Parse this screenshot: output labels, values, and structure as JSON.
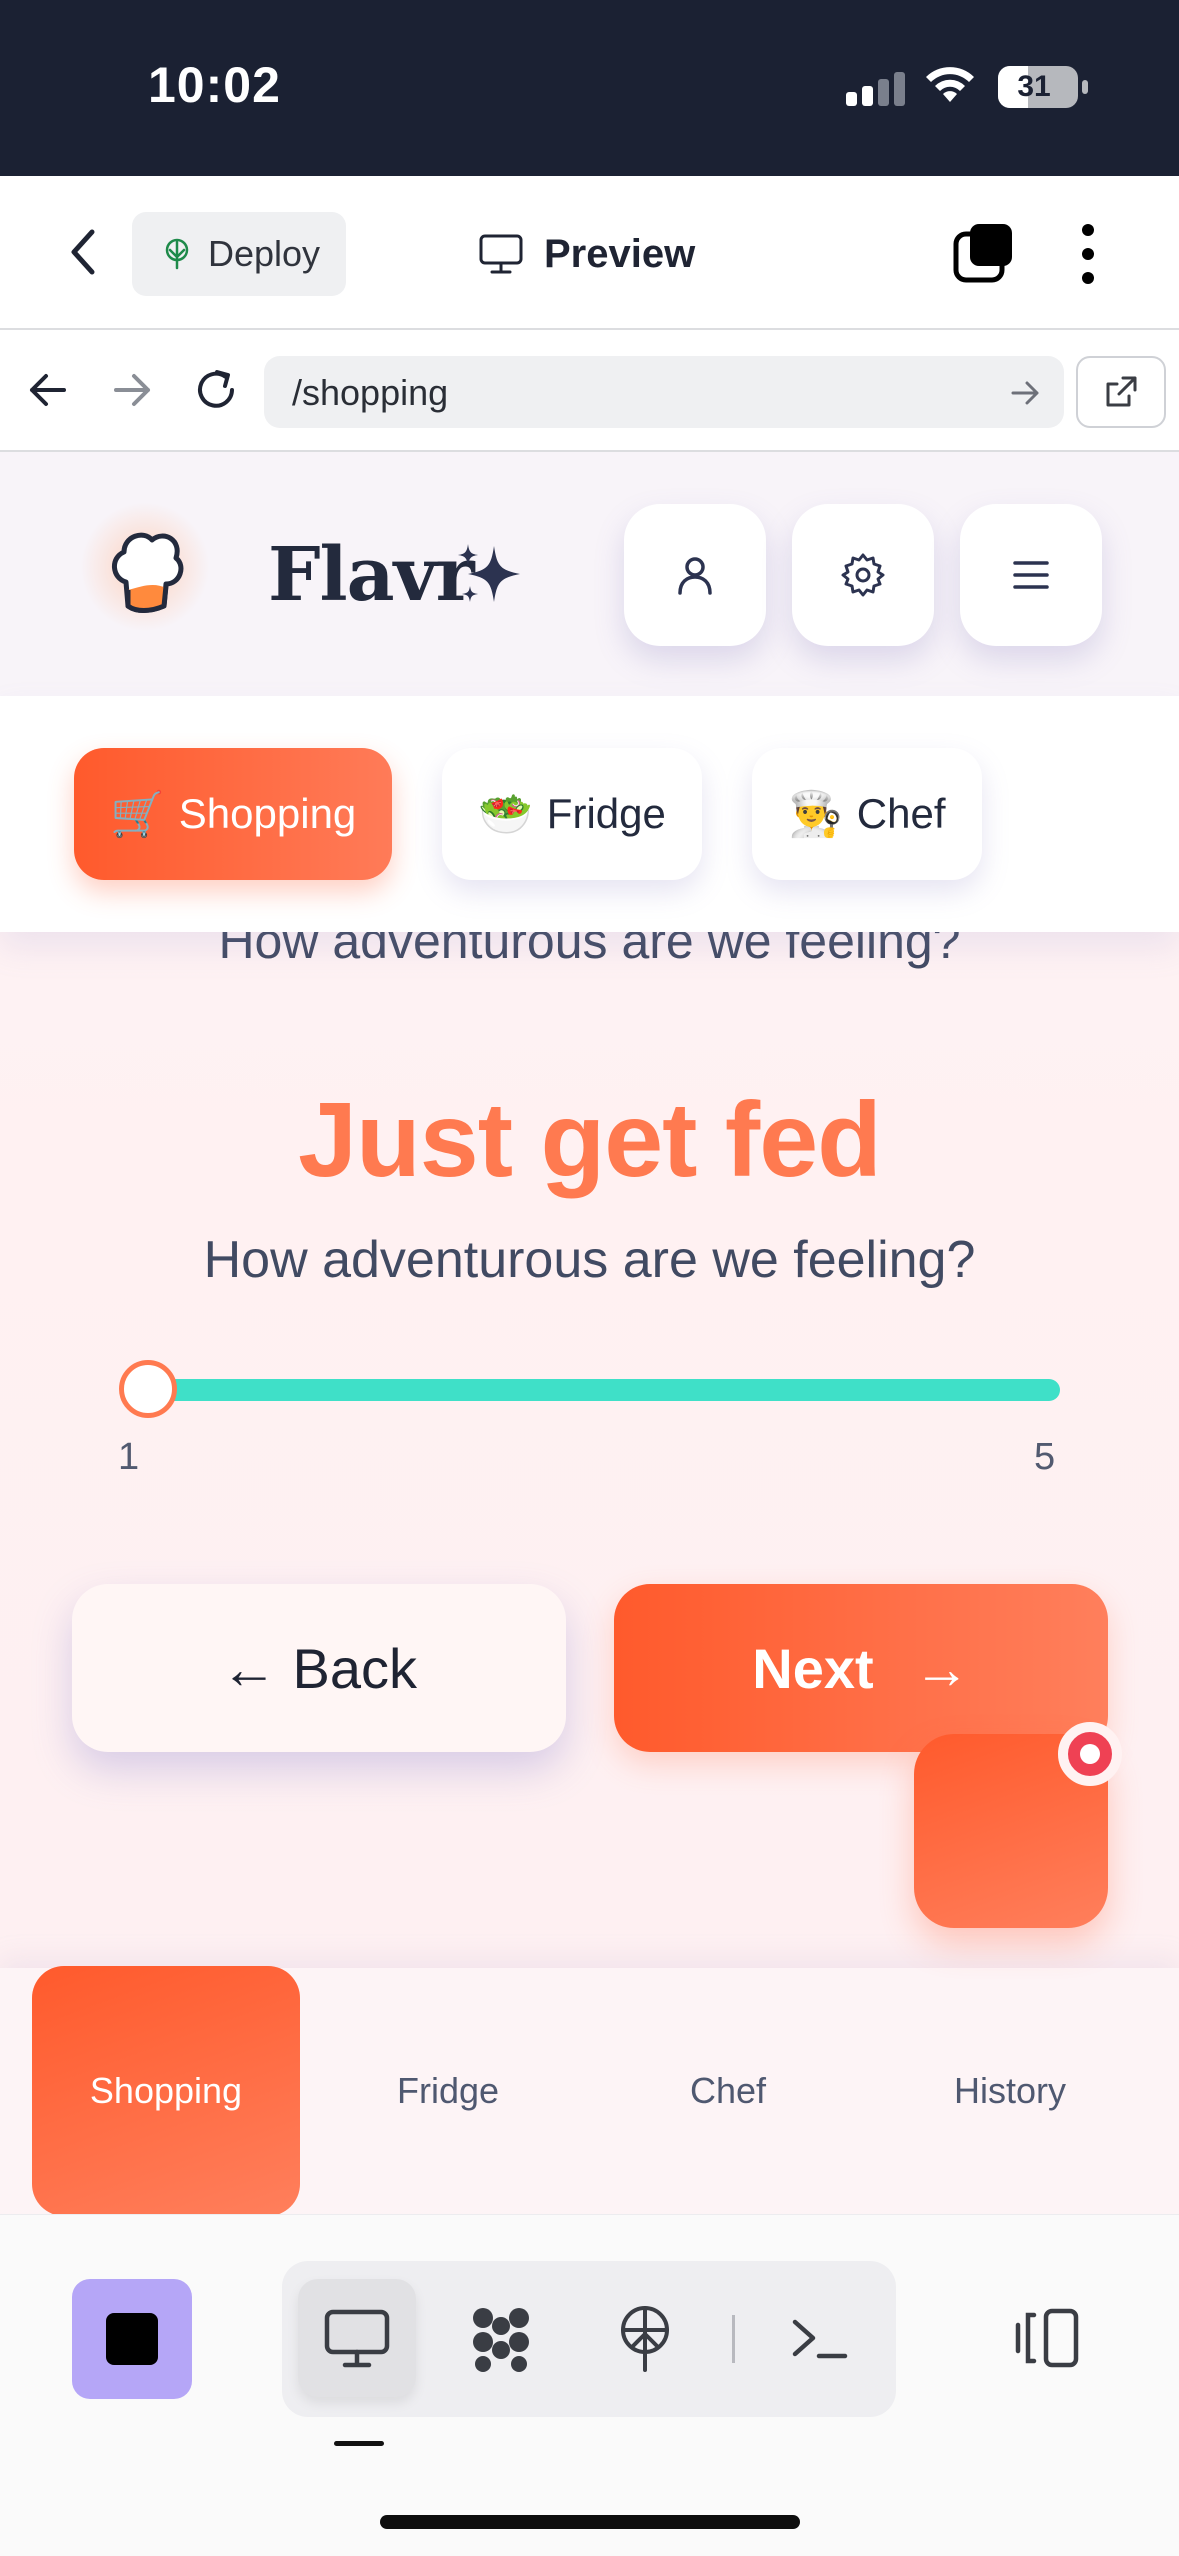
{
  "status_bar": {
    "time": "10:02",
    "battery": "31"
  },
  "editor": {
    "deploy_label": "Deploy",
    "preview_label": "Preview"
  },
  "browser": {
    "url": "/shopping"
  },
  "app": {
    "brand": "Flavr",
    "tabs": [
      {
        "emoji": "🛒",
        "label": "Shopping",
        "active": true
      },
      {
        "emoji": "🥗",
        "label": "Fridge",
        "active": false
      },
      {
        "emoji": "👨‍🍳",
        "label": "Chef",
        "active": false
      }
    ],
    "ghost_question": "How adventurous are we feeling?",
    "level_title": "Just get fed",
    "question": "How adventurous are we feeling?",
    "slider": {
      "min_label": "1",
      "max_label": "5",
      "value": 1,
      "min": 1,
      "max": 5
    },
    "back_label": "← Back",
    "next_label": "Next",
    "next_arrow": "→",
    "bottom_nav": [
      {
        "label": "Shopping",
        "active": true
      },
      {
        "label": "Fridge",
        "active": false
      },
      {
        "label": "Chef",
        "active": false
      },
      {
        "label": "History",
        "active": false
      }
    ]
  },
  "colors": {
    "accent": "#ff5a2c",
    "accent_light": "#ff7a50",
    "slider_track": "#3fe0c8",
    "status_bar_bg": "#1b2133",
    "stop_button": "#b5a6f7"
  },
  "icons": {
    "header_buttons": [
      "user-icon",
      "gear-icon",
      "menu-icon"
    ],
    "toolbar": [
      "monitor-icon",
      "workflow-icon",
      "deploy-icon",
      "terminal-icon"
    ]
  }
}
